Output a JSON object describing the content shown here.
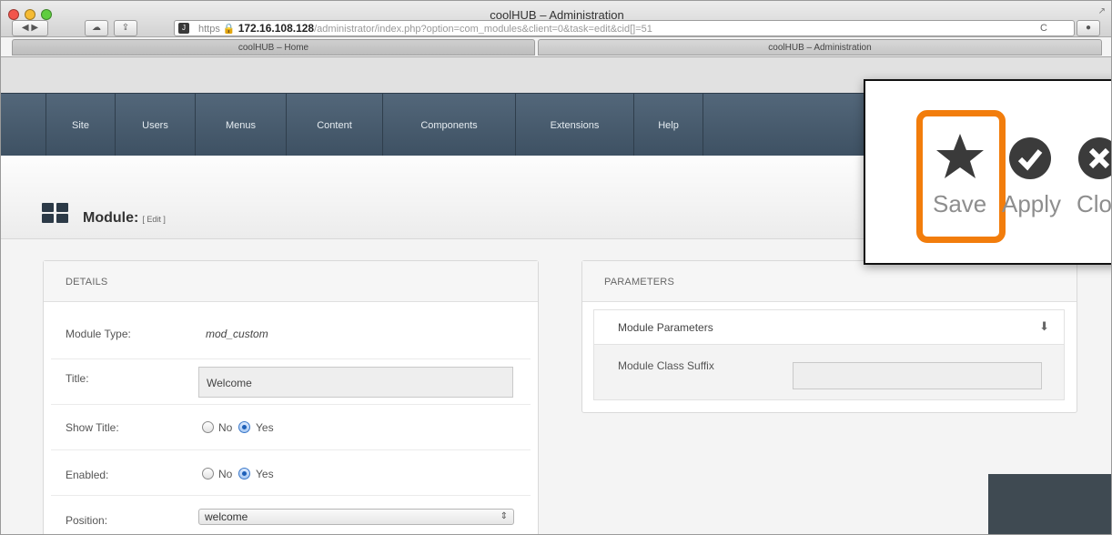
{
  "window": {
    "title": "coolHUB – Administration"
  },
  "toolbar_browser": {
    "url_scheme": "https",
    "url_host": "172.16.108.128",
    "url_path": "/administrator/index.php?option=com_modules&client=0&task=edit&cid[]=51",
    "reader_label": "Reader",
    "reload_glyph": "C"
  },
  "tabs": [
    {
      "label": "coolHUB – Home"
    },
    {
      "label": "coolHUB – Administration"
    }
  ],
  "nav": {
    "items": [
      "Site",
      "Users",
      "Menus",
      "Content",
      "Components",
      "Extensions",
      "Help"
    ]
  },
  "page": {
    "title": "Module:",
    "subtitle": "[ Edit ]"
  },
  "details": {
    "heading": "DETAILS",
    "module_type_label": "Module Type:",
    "module_type_value": "mod_custom",
    "title_label": "Title:",
    "title_value": "Welcome",
    "show_title_label": "Show Title:",
    "enabled_label": "Enabled:",
    "no_label": "No",
    "yes_label": "Yes",
    "position_label": "Position:",
    "position_value": "welcome"
  },
  "parameters": {
    "heading": "PARAMETERS",
    "section_label": "Module Parameters",
    "class_suffix_label": "Module Class Suffix",
    "class_suffix_value": ""
  },
  "callout": {
    "save_label": "Save",
    "apply_label": "Apply",
    "close_label": "Close"
  },
  "colors": {
    "nav_bg": "#485b6d",
    "highlight": "#f27d0c"
  }
}
